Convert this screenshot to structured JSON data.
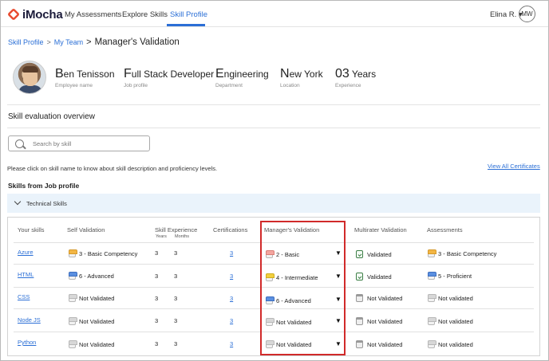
{
  "nav": {
    "logo": "iMocha",
    "links": [
      "My Assessments",
      "Explore Skills",
      "Skill Profile"
    ],
    "user": "Elina R. ▾",
    "avatar": "MW"
  },
  "breadcrumb": {
    "items": [
      "Skill Profile",
      "My Team"
    ],
    "sep1": ">",
    "sep2": ">",
    "current": "Manager's Validation"
  },
  "profile": {
    "name": {
      "initial": "B",
      "rest": "en Tenisson",
      "label": "Employee name"
    },
    "job": {
      "initial": "F",
      "rest": "ull Stack Developer",
      "label": "Job profile"
    },
    "dept": {
      "initial": "E",
      "rest": "ngineering",
      "label": "Department"
    },
    "location": {
      "initial": "N",
      "rest": "ew York",
      "label": "Location"
    },
    "experience": {
      "initial": "03",
      "rest": " Years",
      "label": "Experience"
    }
  },
  "overview": {
    "title": "Skill evaluation overview",
    "search_placeholder": "Search by skill",
    "hint": "Please click on skill name to know about skill description and proficiency levels.",
    "view_all": "View All Certificates",
    "skills_heading": "Skills from Job profile",
    "accordion_label": "Technical Skills"
  },
  "table": {
    "headers": {
      "skills": "Your skills",
      "self": "Self Validation",
      "experience": "Skill Experience",
      "years": "Years",
      "months": "Months",
      "certs": "Certifications",
      "manager": "Manager's Validation",
      "multirater": "Multirater Validation",
      "assessments": "Assessments"
    },
    "rows": [
      {
        "skill": "Azure",
        "self": "3 - Basic Competency",
        "years": "3",
        "months": "3",
        "certs": "3",
        "manager": "2 - Basic",
        "multirater": "Validated",
        "assessment": "3 - Basic Competency"
      },
      {
        "skill": "HTML",
        "self": "6 - Advanced",
        "years": "3",
        "months": "3",
        "certs": "3",
        "manager": "4 - Intermediate",
        "multirater": "Validated",
        "assessment": "5 - Proficient"
      },
      {
        "skill": "CSS",
        "self": "Not Validated",
        "years": "3",
        "months": "3",
        "certs": "3",
        "manager": "6 - Advanced",
        "multirater": "Not Validated",
        "assessment": "Not validated"
      },
      {
        "skill": "Node JS",
        "self": "Not Validated",
        "years": "3",
        "months": "3",
        "certs": "3",
        "manager": "Not Validated",
        "multirater": "Not Validated",
        "assessment": "Not validated"
      },
      {
        "skill": "Python",
        "self": "Not Validated",
        "years": "3",
        "months": "3",
        "certs": "3",
        "manager": "Not Validated",
        "multirater": "Not Validated",
        "assessment": "Not validated"
      }
    ],
    "caret": "▼"
  },
  "colors": {
    "accent": "#2b6fd6",
    "highlight": "#d12a2a",
    "level_basic": "#f2b544",
    "level_intermediate": "#f2cf3d",
    "level_advanced": "#5a8fe0",
    "level_low": "#f4a6a0"
  },
  "icons": [
    "search-icon",
    "chevron-down-icon",
    "proficiency-level-icon",
    "validated-check-icon",
    "not-validated-icon",
    "dropdown-caret-icon"
  ]
}
